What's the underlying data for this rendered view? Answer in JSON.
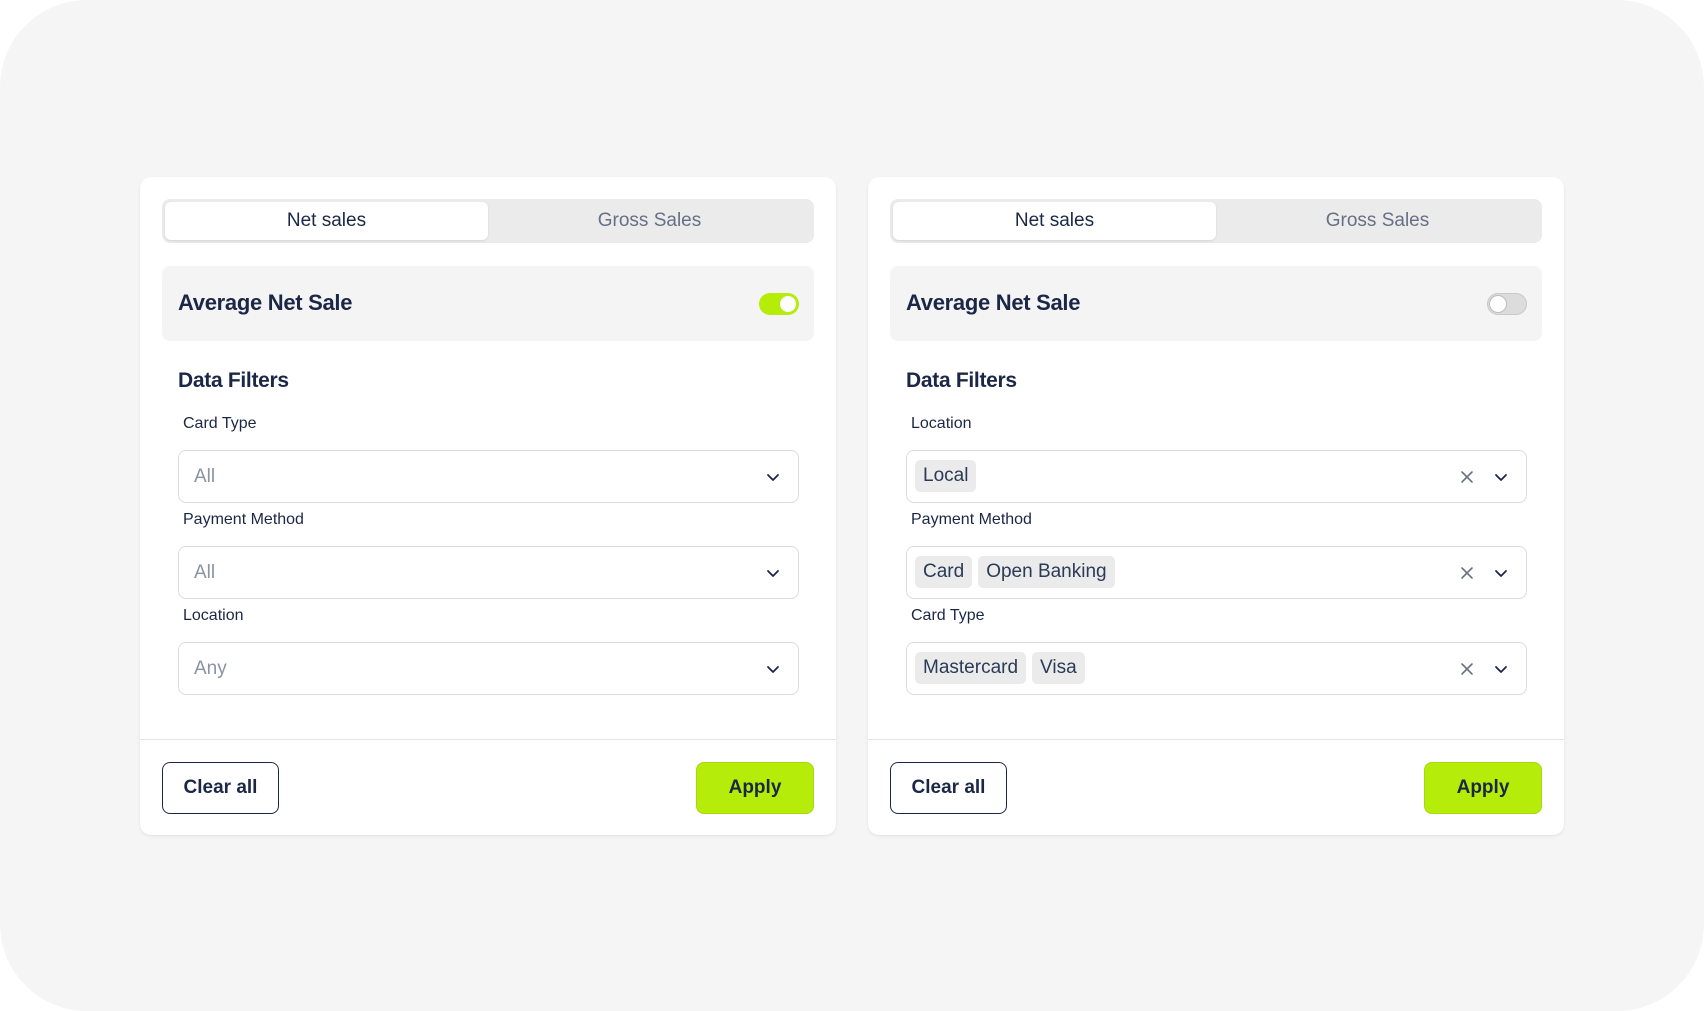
{
  "colors": {
    "accent": "#b5ec0a",
    "text_dark": "#1b2746",
    "muted": "#667085",
    "background": "#f5f5f5"
  },
  "panels": [
    {
      "tabs": [
        {
          "label": "Net sales",
          "active": true
        },
        {
          "label": "Gross Sales",
          "active": false
        }
      ],
      "average": {
        "label": "Average Net Sale",
        "toggle_on": true
      },
      "filters_title": "Data Filters",
      "fields": [
        {
          "label": "Card Type",
          "placeholder": "All",
          "chips": []
        },
        {
          "label": "Payment Method",
          "placeholder": "All",
          "chips": []
        },
        {
          "label": "Location",
          "placeholder": "Any",
          "chips": []
        }
      ],
      "clear_label": "Clear all",
      "apply_label": "Apply"
    },
    {
      "tabs": [
        {
          "label": "Net sales",
          "active": true
        },
        {
          "label": "Gross Sales",
          "active": false
        }
      ],
      "average": {
        "label": "Average Net Sale",
        "toggle_on": false
      },
      "filters_title": "Data Filters",
      "fields": [
        {
          "label": "Location",
          "placeholder": "",
          "chips": [
            "Local"
          ]
        },
        {
          "label": "Payment Method",
          "placeholder": "",
          "chips": [
            "Card",
            "Open Banking"
          ]
        },
        {
          "label": "Card Type",
          "placeholder": "",
          "chips": [
            "Mastercard",
            "Visa"
          ]
        }
      ],
      "clear_label": "Clear all",
      "apply_label": "Apply"
    }
  ],
  "icons": {
    "dropdown": "chevron-down-icon",
    "clear": "close-icon"
  }
}
